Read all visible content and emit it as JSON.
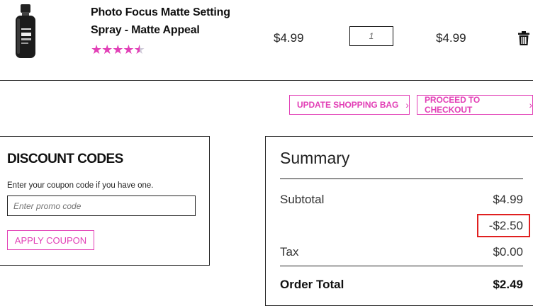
{
  "product": {
    "name": "Photo Focus Matte Setting Spray - Matte Appeal",
    "rating_stars": 4.5,
    "price": "$4.99",
    "quantity": "1",
    "line_total": "$4.99"
  },
  "actions": {
    "update_bag": "UPDATE SHOPPING BAG",
    "checkout": "PROCEED TO CHECKOUT"
  },
  "discount": {
    "title": "DISCOUNT CODES",
    "hint": "Enter your coupon code if you have one.",
    "placeholder": "Enter promo code",
    "apply_label": "APPLY COUPON"
  },
  "summary": {
    "title": "Summary",
    "subtotal_label": "Subtotal",
    "subtotal_value": "$4.99",
    "discount_value": "-$2.50",
    "tax_label": "Tax",
    "tax_value": "$0.00",
    "total_label": "Order Total",
    "total_value": "$2.49"
  },
  "colors": {
    "accent": "#e23fb6",
    "highlight": "#e02020"
  },
  "icons": {
    "chevron": "›",
    "trash": "trash-icon"
  }
}
